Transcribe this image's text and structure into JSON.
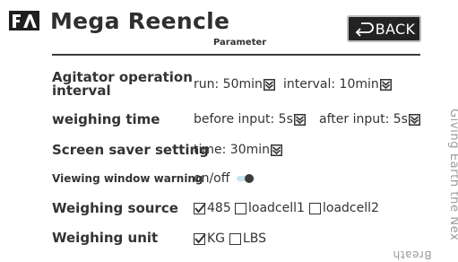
{
  "header": {
    "title": "Mega Reencle",
    "subtitle": "Parameter",
    "back_label": "BACK"
  },
  "settings": {
    "agitator": {
      "label_line1": "Agitator operation",
      "label_line2": "interval",
      "run": "run: 50min",
      "interval": "interval: 10min"
    },
    "weighing_time": {
      "label": "weighing time",
      "before": "before input: 5s",
      "after": "after input: 5s"
    },
    "screen_saver": {
      "label": "Screen saver setting",
      "time": "time: 30min"
    },
    "viewing_warning": {
      "label": "Viewing window warning",
      "value": "on/off",
      "enabled": true
    },
    "weighing_source": {
      "label": "Weighing source",
      "options": [
        {
          "label": "485",
          "checked": true
        },
        {
          "label": "loadcell1",
          "checked": false
        },
        {
          "label": "loadcell2",
          "checked": false
        }
      ]
    },
    "weighing_unit": {
      "label": "Weighing unit",
      "options": [
        {
          "label": "KG",
          "checked": true
        },
        {
          "label": "LBS",
          "checked": false
        }
      ]
    }
  },
  "side": {
    "slogan": "Giving Earth the Nex",
    "corner": "Breath"
  },
  "colors": {
    "button_bg": "#232323",
    "toggle_track": "#c9e3ee",
    "text": "#333333"
  }
}
